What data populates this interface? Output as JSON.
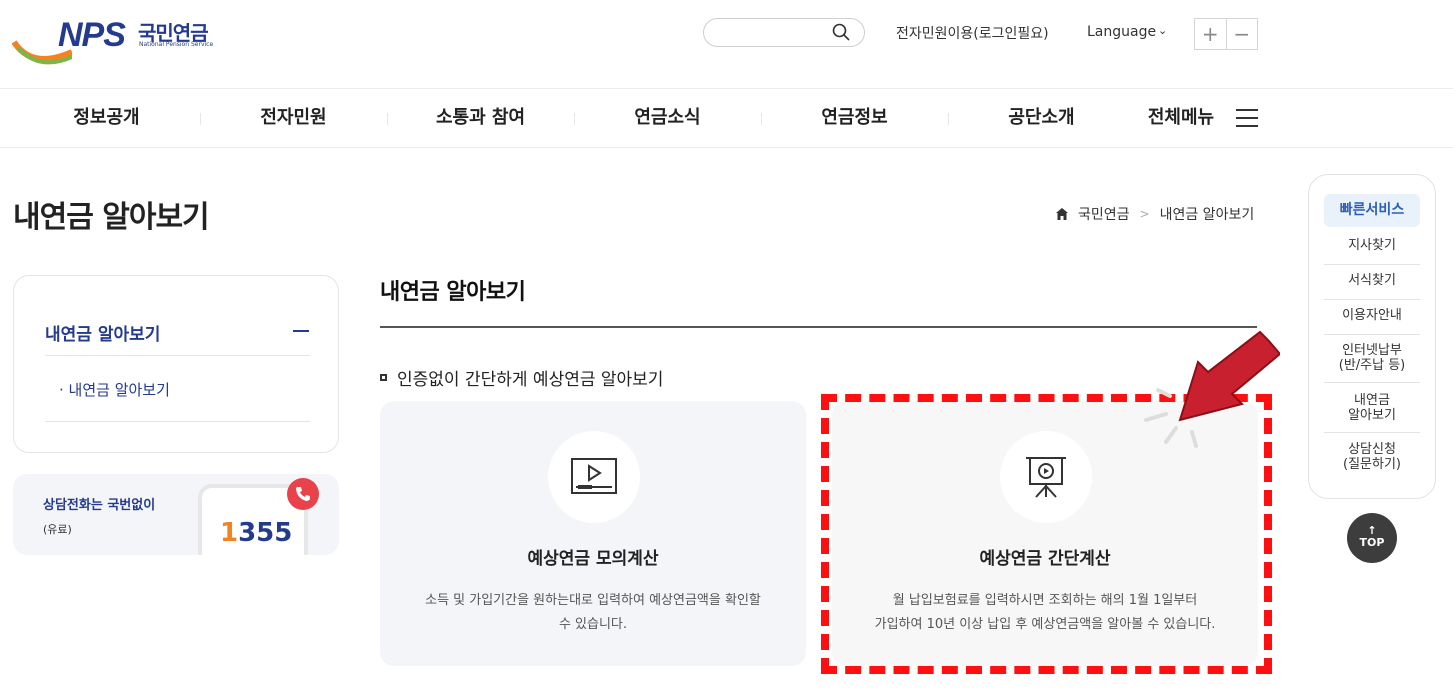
{
  "header": {
    "logo_text": "NPS",
    "logo_kr": "국민연금",
    "logo_en": "National Pension Service",
    "search_placeholder": "",
    "civil_link": "전자민원이용(로그인필요)",
    "language_label": "Language",
    "zoom_in": "+",
    "zoom_out": "−"
  },
  "gnb": {
    "items": [
      "정보공개",
      "전자민원",
      "소통과 참여",
      "연금소식",
      "연금정보",
      "공단소개"
    ],
    "full_menu": "전체메뉴"
  },
  "page": {
    "title": "내연금 알아보기",
    "breadcrumb": [
      "국민연금",
      "내연금 알아보기"
    ]
  },
  "lnb": {
    "title": "내연금 알아보기",
    "sub_item": "· 내연금 알아보기"
  },
  "call": {
    "title": "상담전화는 국번없이",
    "sub": "(유료)",
    "number_first": "1",
    "number_rest": "355"
  },
  "content": {
    "title": "내연금 알아보기",
    "heading": "인증없이 간단하게 예상연금 알아보기",
    "cards": [
      {
        "title": "예상연금 모의계산",
        "desc_line1": "소득 및 가입기간을 원하는대로 입력하여 예상연금액을 확인할",
        "desc_line2": "수 있습니다.",
        "icon": "video-player-icon"
      },
      {
        "title": "예상연금 간단계산",
        "desc_line1": "월 납입보험료를 입력하시면 조회하는 해의 1월 1일부터",
        "desc_line2": "가입하여 10년 이상 납입 후 예상연금액을 알아볼 수 있습니다.",
        "icon": "presentation-board-icon"
      }
    ]
  },
  "quick": {
    "head": "빠른서비스",
    "items": [
      [
        "지사찾기"
      ],
      [
        "서식찾기"
      ],
      [
        "이용자안내"
      ],
      [
        "인터넷납부",
        "(반/주납 등)"
      ],
      [
        "내연금",
        "알아보기"
      ],
      [
        "상담신청",
        "(질문하기)"
      ]
    ],
    "top_label": "TOP",
    "top_arrow": "↑"
  },
  "colors": {
    "brand_blue": "#233a8f",
    "brand_orange": "#f5821f",
    "highlight_red": "#ff1010"
  }
}
